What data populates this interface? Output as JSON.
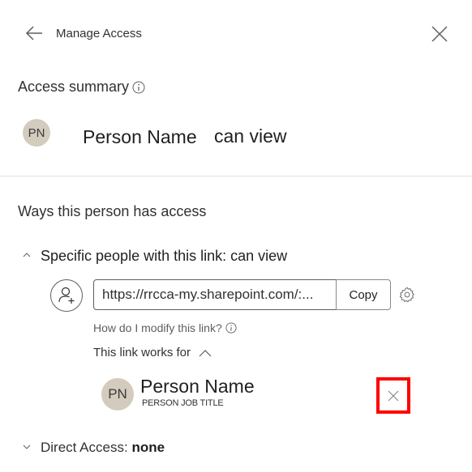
{
  "header": {
    "title": "Manage Access",
    "back_icon": "arrow-left-icon",
    "close_icon": "close-icon"
  },
  "summary": {
    "title": "Access summary",
    "info_icon": "info-icon",
    "avatar_initials": "PN",
    "person_name": "Person Name",
    "permission": "can view",
    "avatar_color": "#d3cbbd"
  },
  "ways": {
    "title": "Ways this person has access",
    "link_section": {
      "title": "Specific people with this link: can view",
      "expanded": true,
      "link_url": "https://rrcca-my.sharepoint.com/:...",
      "copy_label": "Copy",
      "modify_label": "How do I modify this link?",
      "works_for_label": "This link works for",
      "people": [
        {
          "initials": "PN",
          "name": "Person Name",
          "job_title": "PERSON JOB TITLE"
        }
      ]
    },
    "direct_access": {
      "label": "Direct Access:",
      "value": "none",
      "expanded": false
    }
  },
  "colors": {
    "highlight": "#ff0000",
    "text": "#323130",
    "divider": "#e1dfdd"
  }
}
